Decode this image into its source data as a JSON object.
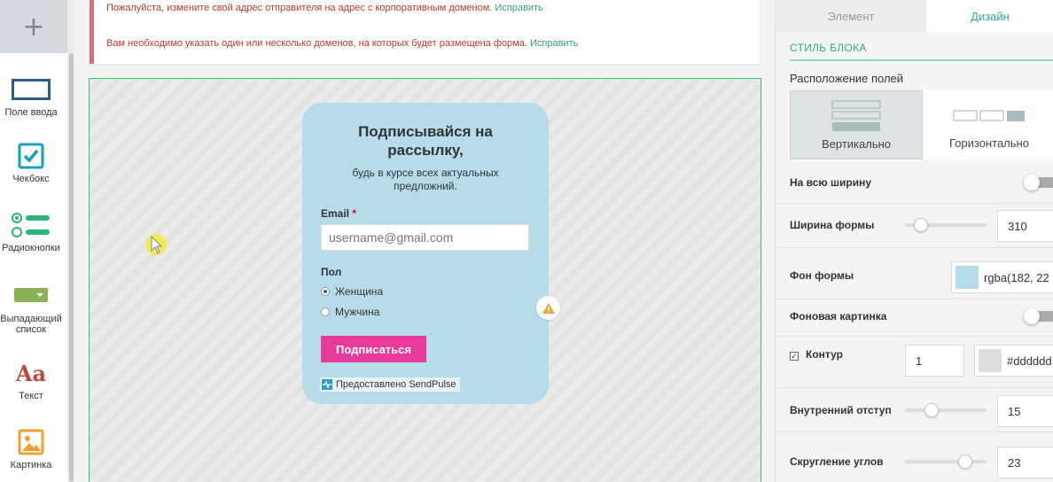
{
  "toolbar": {
    "add_symbol": "+",
    "items": [
      {
        "label": "Поле ввода",
        "icon": "input-field-icon"
      },
      {
        "label": "Чекбокс",
        "icon": "checkbox-icon"
      },
      {
        "label": "Радиокнопки",
        "icon": "radio-buttons-icon"
      },
      {
        "label": "Выпадающий список",
        "icon": "dropdown-icon"
      },
      {
        "label": "Текст",
        "icon": "text-icon",
        "glyph": "Aa"
      },
      {
        "label": "Картинка",
        "icon": "image-icon"
      }
    ]
  },
  "alerts": [
    {
      "text": "Пожалуйста, измените свой адрес отправителя на адрес с корпоративным доменом.",
      "link": "Исправить"
    },
    {
      "text": "Вам необходимо указать один или несколько доменов, на которых будет размещена форма.",
      "link": "Исправить"
    }
  ],
  "form": {
    "title_line1": "Подписывайся на",
    "title_line2": "рассылку,",
    "subtitle_line1": "будь в курсе всех актуальных",
    "subtitle_line2": "предложний.",
    "email_label": "Email",
    "required_mark": "*",
    "email_placeholder": "username@gmail.com",
    "sex_label": "Пол",
    "options": [
      {
        "label": "Женщина",
        "selected": true
      },
      {
        "label": "Мужчина",
        "selected": false
      }
    ],
    "submit_label": "Подписаться",
    "powered_by": "Предоставлено SendPulse",
    "background": "#b6dcea",
    "button_color": "#e73a9c"
  },
  "panel": {
    "tabs": [
      {
        "label": "Элемент",
        "active": false
      },
      {
        "label": "Дизайн",
        "active": true
      }
    ],
    "section_title": "СТИЛЬ БЛОКА",
    "layout_label": "Расположение полей",
    "layout_options": [
      {
        "label": "Вертикально",
        "selected": true
      },
      {
        "label": "Горизонтально",
        "selected": false
      }
    ],
    "full_width": {
      "label": "На всю ширину",
      "on": false
    },
    "form_width": {
      "label": "Ширина формы",
      "value": "310",
      "slider": 0.2
    },
    "form_bg": {
      "label": "Фон формы",
      "value": "rgba(182, 22",
      "swatch": "#b6dcea"
    },
    "bg_image": {
      "label": "Фоновая картинка",
      "on": false
    },
    "border": {
      "label": "Контур",
      "checked": true,
      "check_mark": "✓",
      "width": "1",
      "color_value": "#dddddd",
      "swatch": "#dddddd"
    },
    "padding": {
      "label": "Внутренний отступ",
      "value": "15",
      "slider": 0.32
    },
    "radius": {
      "label": "Скругление углов",
      "value": "23",
      "slider": 0.74
    }
  },
  "colors": {
    "accent": "#2faa8f",
    "alert": "#c0392b",
    "stage_border": "#39c36b"
  }
}
